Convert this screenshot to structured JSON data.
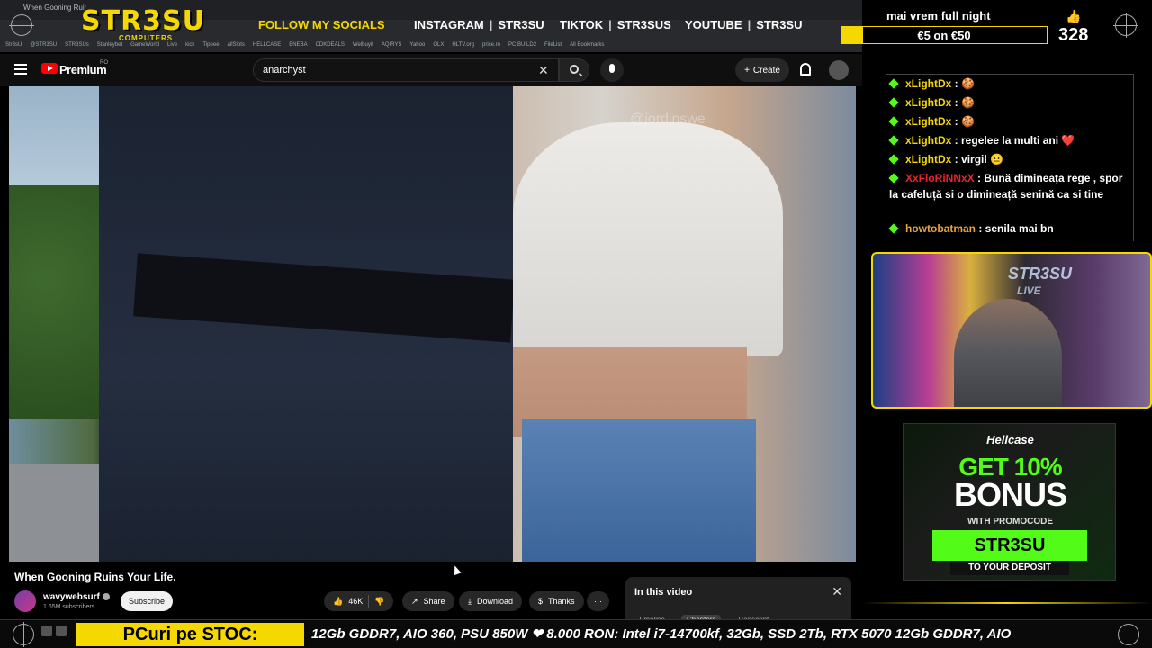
{
  "browser": {
    "tab_title": "When Gooning Ruins You...",
    "bookmarks": [
      "Str3sU",
      "@STR3SU",
      "STR3SUs",
      "Stanleybet",
      "GameWorld",
      "Live",
      "kick",
      "Tipeee",
      "allSlots",
      "HELLCASE",
      "ENEBA",
      "CDKDEALS",
      "Welbuyit",
      "AQIRYS",
      "Yahoo",
      "OLX",
      "HLTV.org",
      "price.ro",
      "PC BUILD2",
      "FileList",
      "All Bookmarks"
    ]
  },
  "overlay": {
    "logo": "STR3SU",
    "logo_sub": "COMPUTERS",
    "follow_label": "FOLLOW MY SOCIALS",
    "socials": [
      {
        "platform": "INSTAGRAM",
        "handle": "STR3SU"
      },
      {
        "platform": "TIKTOK",
        "handle": "STR3SUS"
      },
      {
        "platform": "YOUTUBE",
        "handle": "STR3SU"
      }
    ],
    "promo_title": "mai vrem full night",
    "promo_value": "€5 on €50",
    "like_count": "328"
  },
  "youtube": {
    "brand": "Premium",
    "country": "RO",
    "search_value": "anarchyst",
    "create_label": "Create",
    "video_title": "When Gooning Ruins Your Life.",
    "channel_name": "wavywebsurf",
    "channel_subs": "1.65M subscribers",
    "subscribe_label": "Subscribe",
    "likes": "46K",
    "share_label": "Share",
    "download_label": "Download",
    "thanks_label": "Thanks",
    "more_label": "···",
    "in_this_video": "In this video",
    "itv_tabs": [
      "Timeline",
      "Chapters",
      "Transcript"
    ],
    "watermark": "@jordinswe"
  },
  "chat": {
    "messages": [
      {
        "user": "xLightDx",
        "text": "🍪",
        "color": "#f5d800"
      },
      {
        "user": "xLightDx",
        "text": "🍪",
        "color": "#f5d800"
      },
      {
        "user": "xLightDx",
        "text": "🍪",
        "color": "#f5d800"
      },
      {
        "user": "xLightDx",
        "text": "regelee la multi ani ❤️",
        "color": "#f5d800"
      },
      {
        "user": "xLightDx",
        "text": "virgil 😐",
        "color": "#f5d800"
      },
      {
        "user": "XxFloRiNNxX",
        "text": "Bună dimineața rege , spor la cafeluță si o dimineață senină ca si tine",
        "color": "#e3262e"
      },
      {
        "user": "howtobatman",
        "text": "senila mai bn",
        "color": "#e9a23b"
      }
    ]
  },
  "webcam": {
    "tag": "STR3SU",
    "tag2": "LIVE"
  },
  "hellcase": {
    "brand": "Hellcase",
    "headline": "GET 10%",
    "bonus": "BONUS",
    "with": "WITH PROMOCODE",
    "code": "STR3SU",
    "deposit": "TO YOUR DEPOSIT"
  },
  "ticker": {
    "label": "PCuri pe STOC:",
    "text": "12Gb GDDR7, AIO 360, PSU 850W  ❤ 8.000 RON: Intel i7-14700kf, 32Gb, SSD 2Tb, RTX 5070 12Gb GDDR7, AIO"
  },
  "colors": {
    "accent": "#f5d800",
    "kick_green": "#53fc18",
    "yt_red": "#ff0000"
  }
}
